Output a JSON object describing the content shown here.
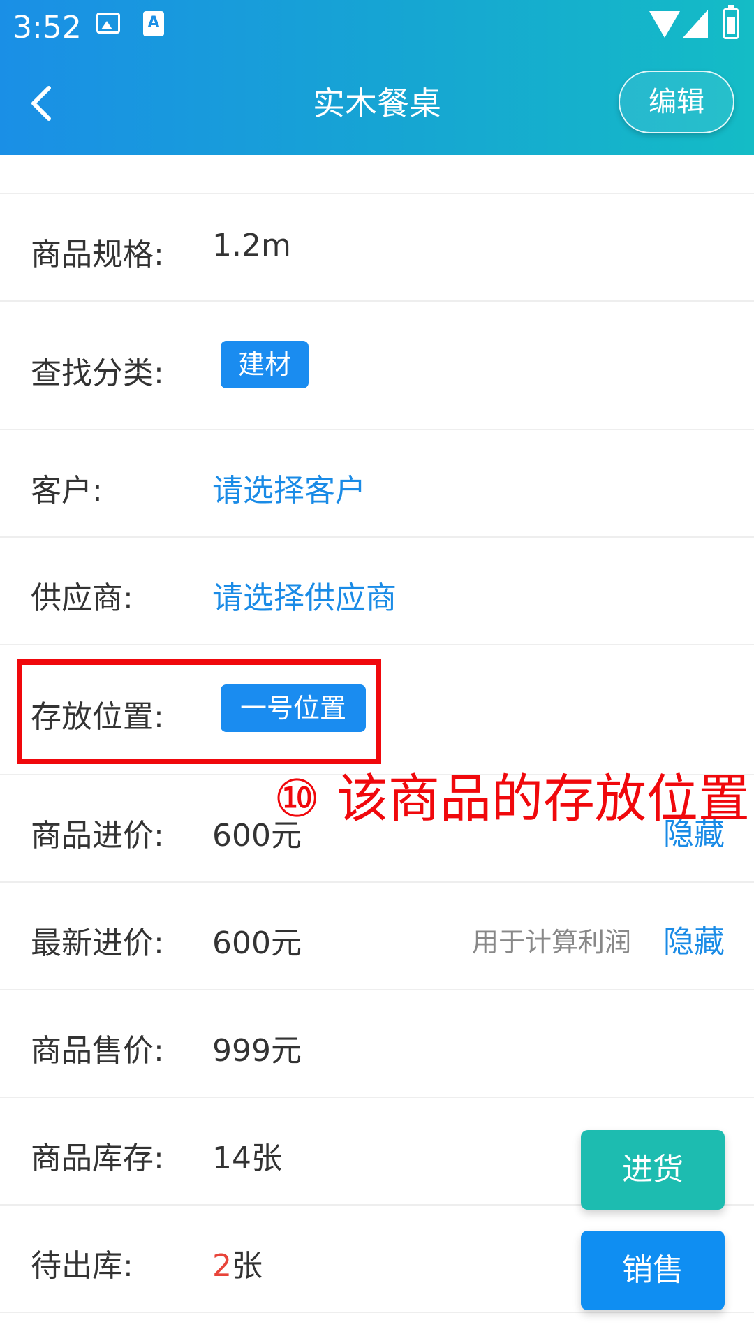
{
  "status_bar": {
    "time": "3:52"
  },
  "header": {
    "title": "实木餐桌",
    "edit_label": "编辑"
  },
  "rows": {
    "spec": {
      "label": "商品规格:",
      "value": "1.2m"
    },
    "category": {
      "label": "查找分类:",
      "tag": "建材"
    },
    "customer": {
      "label": "客户:",
      "link": "请选择客户"
    },
    "supplier": {
      "label": "供应商:",
      "link": "请选择供应商"
    },
    "location": {
      "label": "存放位置:",
      "tag": "一号位置"
    },
    "purchase_price": {
      "label": "商品进价:",
      "value": "600元",
      "action": "隐藏"
    },
    "latest_price": {
      "label": "最新进价:",
      "value": "600元",
      "hint": "用于计算利润",
      "action": "隐藏"
    },
    "sale_price": {
      "label": "商品售价:",
      "value": "999元"
    },
    "stock": {
      "label": "商品库存:",
      "value": "14张"
    },
    "pending": {
      "label": "待出库:",
      "count": "2",
      "unit": "张"
    }
  },
  "annotation": {
    "text": "⑩ 该商品的存放位置"
  },
  "fab": {
    "stock_in": "进货",
    "sell": "销售"
  },
  "colors": {
    "accent_blue": "#1a8be6",
    "tag_blue": "#1a8cf0",
    "annotation_red": "#f0080c",
    "teal": "#1dbcb0"
  }
}
